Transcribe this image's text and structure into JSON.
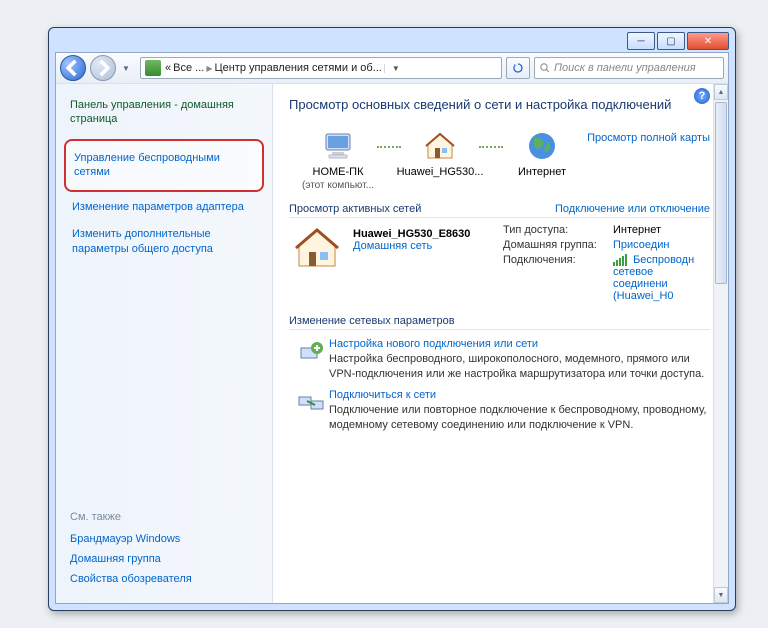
{
  "breadcrumb": {
    "prefix": "«",
    "part1": "Все ...",
    "part2": "Центр управления сетями и об..."
  },
  "search": {
    "placeholder": "Поиск в панели управления"
  },
  "sidebar": {
    "home": "Панель управления - домашняя страница",
    "items": [
      "Управление беспроводными сетями",
      "Изменение параметров адаптера",
      "Изменить дополнительные параметры общего доступа"
    ],
    "also_header": "См. также",
    "also": [
      "Брандмауэр Windows",
      "Домашняя группа",
      "Свойства обозревателя"
    ]
  },
  "main": {
    "heading": "Просмотр основных сведений о сети и настройка подключений",
    "fullmap_link": "Просмотр полной карты",
    "map": {
      "pc_name": "HOME-ПК",
      "pc_sub": "(этот компьют...",
      "router_name": "Huawei_HG530...",
      "internet": "Интернет"
    },
    "active_title": "Просмотр активных сетей",
    "active_link": "Подключение или отключение",
    "network": {
      "name": "Huawei_HG530_E8630",
      "type": "Домашняя сеть",
      "access_k": "Тип доступа:",
      "access_v": "Интернет",
      "homegroup_k": "Домашняя группа:",
      "homegroup_v": "Присоедин",
      "conn_k": "Подключения:",
      "conn_v": "Беспроводн сетевое соединени (Huawei_H0"
    },
    "params_title": "Изменение сетевых параметров",
    "tasks": [
      {
        "title": "Настройка нового подключения или сети",
        "desc": "Настройка беспроводного, широкополосного, модемного, прямого или VPN-подключения или же настройка маршрутизатора или точки доступа."
      },
      {
        "title": "Подключиться к сети",
        "desc": "Подключение или повторное подключение к беспроводному, проводному, модемному сетевому соединению или подключение к VPN."
      }
    ]
  }
}
